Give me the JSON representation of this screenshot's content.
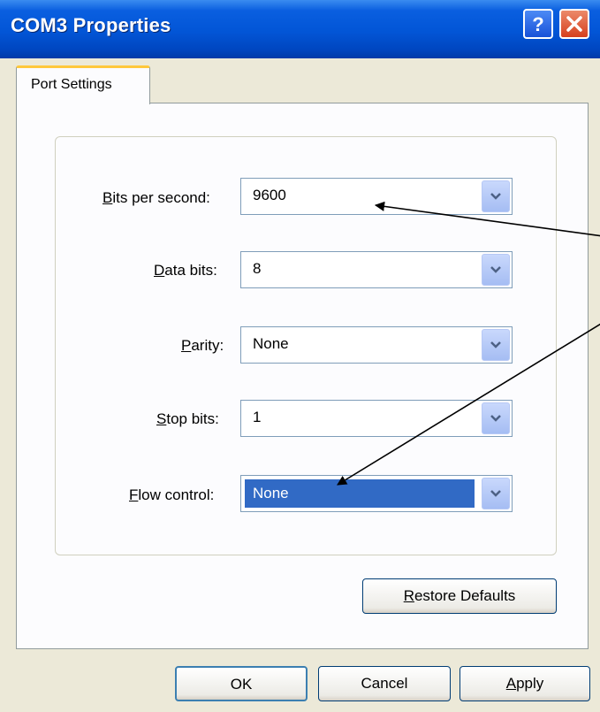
{
  "window": {
    "title": "COM3 Properties"
  },
  "titlebar_buttons": {
    "help": "?",
    "close": "×"
  },
  "tabs": [
    {
      "label": "Port Settings",
      "active": true
    }
  ],
  "settings": [
    {
      "label_key": "B",
      "label_rest": "its per second:",
      "value": "9600",
      "selected": false
    },
    {
      "label_key": "D",
      "label_rest": "ata bits:",
      "value": "8",
      "selected": false
    },
    {
      "label_key": "P",
      "label_rest": "arity:",
      "value": "None",
      "selected": false
    },
    {
      "label_key": "S",
      "label_rest": "top bits:",
      "value": "1",
      "selected": false
    },
    {
      "label_key": "F",
      "label_rest": "low control:",
      "value": "None",
      "selected": true
    }
  ],
  "buttons": {
    "restore_key": "R",
    "restore_rest": "estore Defaults",
    "ok": "OK",
    "cancel": "Cancel",
    "apply_key": "A",
    "apply_rest": "pply"
  },
  "colors": {
    "titlebar": "#0255d6",
    "selection": "#316ac5",
    "dialog_bg": "#ece9d8",
    "close_button": "#d6401e"
  }
}
